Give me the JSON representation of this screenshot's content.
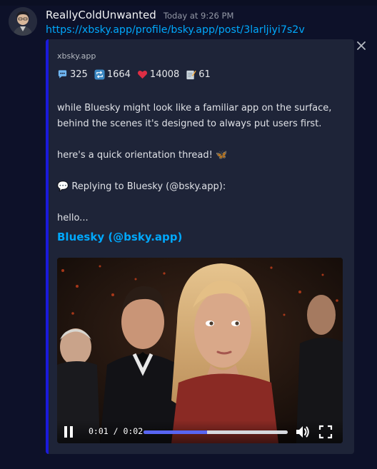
{
  "message": {
    "username": "ReallyColdUnwanted",
    "timestamp": "Today at 9:26 PM",
    "link": "https://xbsky.app/profile/bsky.app/post/3larljiyi7s2v",
    "avatar_icon": "user-avatar"
  },
  "embed": {
    "provider": "xbsky.app",
    "accent_color": "#1a1adb",
    "stats": [
      {
        "icon": "speech-bubble-icon",
        "value": "325"
      },
      {
        "icon": "repost-icon",
        "value": "1664"
      },
      {
        "icon": "heart-icon",
        "value": "14008"
      },
      {
        "icon": "memo-icon",
        "value": "61"
      }
    ],
    "description": {
      "line1": "while Bluesky might look like a familiar app on the surface,",
      "line2": "behind the scenes it's designed to always put users first.",
      "thread": "here's a quick orientation thread! 🦋",
      "reply": "💬 Replying to Bluesky (@bsky.app):",
      "hello": "hello..."
    },
    "author": "Bluesky (@bsky.app)",
    "close_icon": "close-icon"
  },
  "video": {
    "time": "0:01 / 0:02",
    "progress": 0.44,
    "controls": [
      "pause-icon",
      "volume-icon",
      "fullscreen-icon"
    ]
  }
}
